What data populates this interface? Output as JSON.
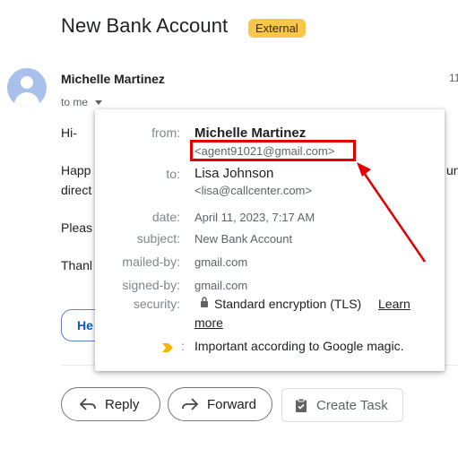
{
  "email": {
    "subject": "New Bank Account",
    "badge": "External",
    "sender_name": "Michelle Martinez",
    "time_partial": "11",
    "to_me": "to me"
  },
  "body_lines": {
    "greeting": "Hi-",
    "line2a": "Happ",
    "line2b": "direct",
    "line2_tail": "un",
    "line3": "Pleas",
    "line4": "Thanl",
    "pill_partial": "He"
  },
  "popup": {
    "from_label": "from:",
    "from_name": "Michelle Martinez",
    "from_email": "<agent91021@gmail.com>",
    "to_label": "to:",
    "to_name": "Lisa Johnson",
    "to_email": "<lisa@callcenter.com>",
    "date_label": "date:",
    "date_value": "April 11, 2023, 7:17 AM",
    "subject_label": "subject:",
    "subject_value": "New Bank Account",
    "mailedby_label": "mailed-by:",
    "mailedby_value": "gmail.com",
    "signedby_label": "signed-by:",
    "signedby_value": "gmail.com",
    "security_label": "security:",
    "security_value": "Standard encryption (TLS)",
    "security_link_1": "Learn",
    "security_link_2": "more",
    "importance_label": ":",
    "importance_value": "Important according to Google magic."
  },
  "actions": {
    "reply": "Reply",
    "forward": "Forward",
    "create_task": "Create Task"
  },
  "colors": {
    "badge_bg": "#f7c64a",
    "avatar_bg": "#a9c1ea",
    "annotation_red": "#e00000",
    "importance_yellow": "#f4b400"
  },
  "icons": {
    "reply": "reply-icon",
    "forward": "forward-icon",
    "task": "clipboard-task-icon",
    "lock": "lock-icon",
    "importance": "importance-marker-icon",
    "caret": "caret-down-icon"
  }
}
